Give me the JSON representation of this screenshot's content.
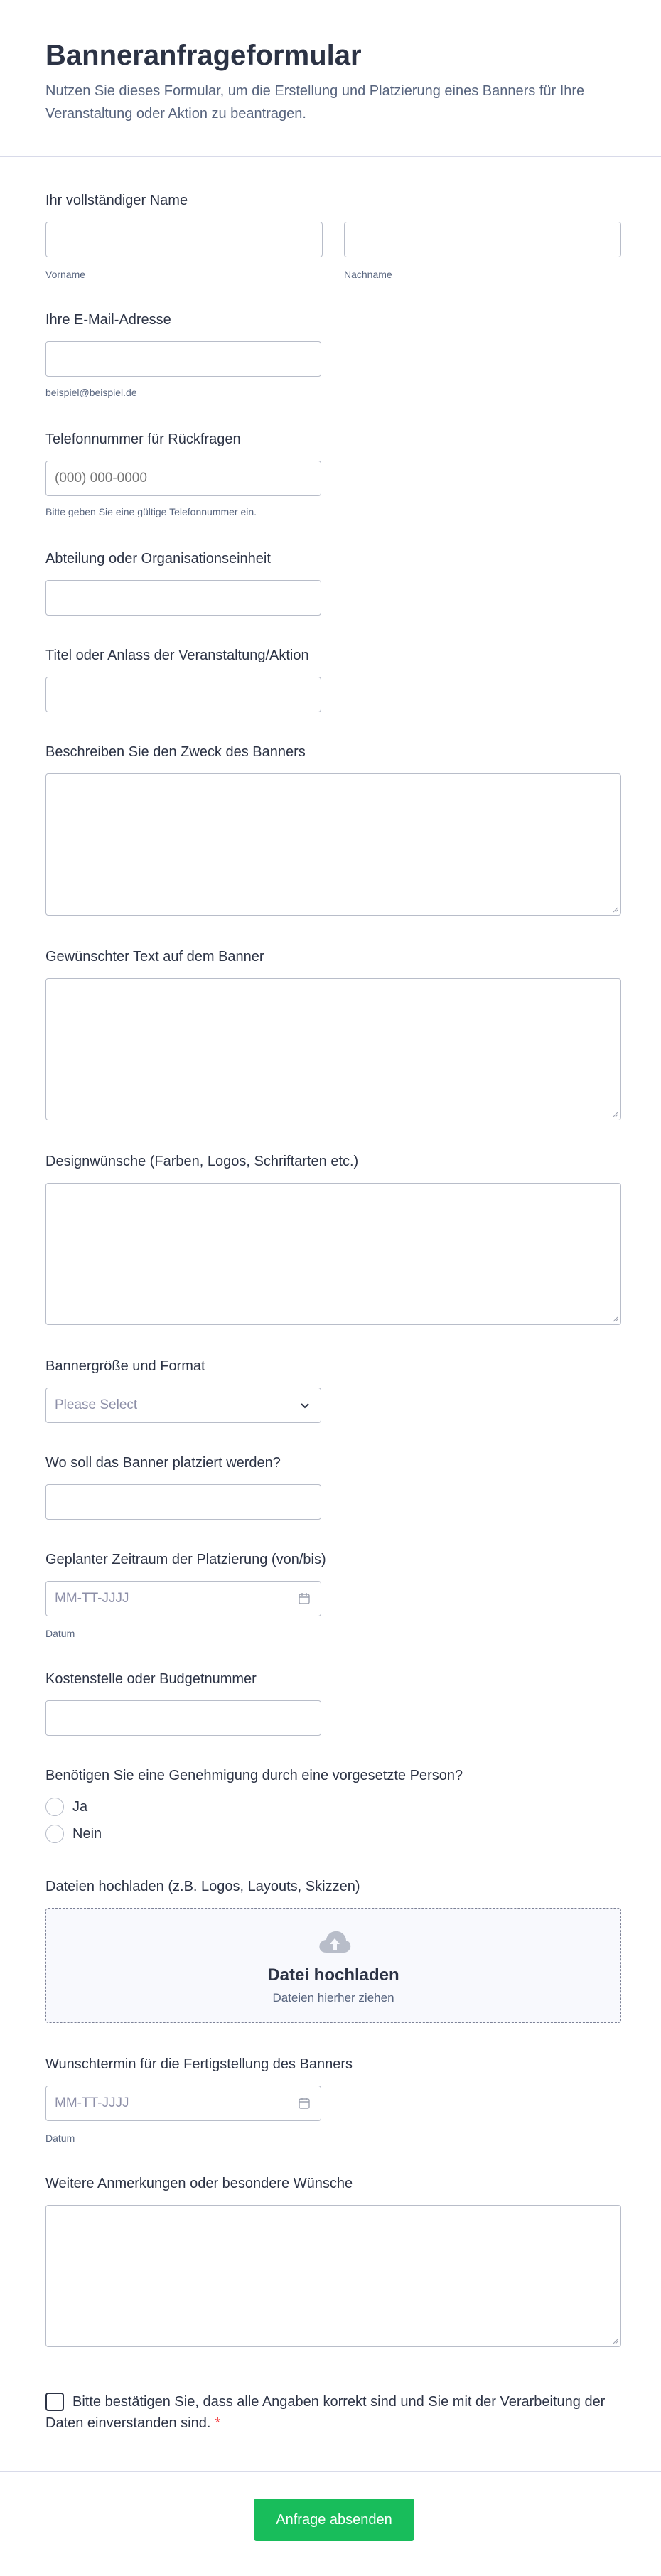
{
  "header": {
    "title": "Banneranfrageformular",
    "subtitle": "Nutzen Sie dieses Formular, um die Erstellung und Platzierung eines Banners für Ihre Veranstaltung oder Aktion zu beantragen."
  },
  "fields": {
    "full_name": {
      "label": "Ihr vollständiger Name",
      "first_sublabel": "Vorname",
      "last_sublabel": "Nachname",
      "first_value": "",
      "last_value": ""
    },
    "email": {
      "label": "Ihre E-Mail-Adresse",
      "sublabel": "beispiel@beispiel.de",
      "value": ""
    },
    "phone": {
      "label": "Telefonnummer für Rückfragen",
      "placeholder": "(000) 000-0000",
      "sublabel": "Bitte geben Sie eine gültige Telefonnummer ein."
    },
    "department": {
      "label": "Abteilung oder Organisationseinheit",
      "value": ""
    },
    "event_title": {
      "label": "Titel oder Anlass der Veranstaltung/Aktion",
      "value": ""
    },
    "purpose": {
      "label": "Beschreiben Sie den Zweck des Banners",
      "value": ""
    },
    "banner_text": {
      "label": "Gewünschter Text auf dem Banner",
      "value": ""
    },
    "design": {
      "label": "Designwünsche (Farben, Logos, Schriftarten etc.)",
      "value": ""
    },
    "size_format": {
      "label": "Bannergröße und Format",
      "placeholder": "Please Select",
      "icon": "chevron-down-icon"
    },
    "placement": {
      "label": "Wo soll das Banner platziert werden?",
      "value": ""
    },
    "period": {
      "label": "Geplanter Zeitraum der Platzierung (von/bis)",
      "placeholder": "MM-TT-JJJJ",
      "sublabel": "Datum",
      "icon": "calendar-icon"
    },
    "cost_center": {
      "label": "Kostenstelle oder Budgetnummer",
      "value": ""
    },
    "approval": {
      "label": "Benötigen Sie eine Genehmigung durch eine vorgesetzte Person?",
      "options": [
        "Ja",
        "Nein"
      ]
    },
    "upload": {
      "label": "Dateien hochladen (z.B. Logos, Layouts, Skizzen)",
      "title": "Datei hochladen",
      "subtitle": "Dateien hierher ziehen",
      "icon": "cloud-upload-icon"
    },
    "completion_date": {
      "label": "Wunschtermin für die Fertigstellung des Banners",
      "placeholder": "MM-TT-JJJJ",
      "sublabel": "Datum",
      "icon": "calendar-icon"
    },
    "notes": {
      "label": "Weitere Anmerkungen oder besondere Wünsche",
      "value": ""
    },
    "consent": {
      "text": "Bitte bestätigen Sie, dass alle Angaben korrekt sind und Sie mit der Verarbeitung der Daten einverstanden sind.",
      "required_mark": "*"
    }
  },
  "submit": {
    "label": "Anfrage absenden"
  },
  "colors": {
    "accent": "#18bd5b",
    "text": "#2c3345",
    "muted": "#57647e",
    "border": "#b8bdc9",
    "required": "#f23a3c"
  }
}
